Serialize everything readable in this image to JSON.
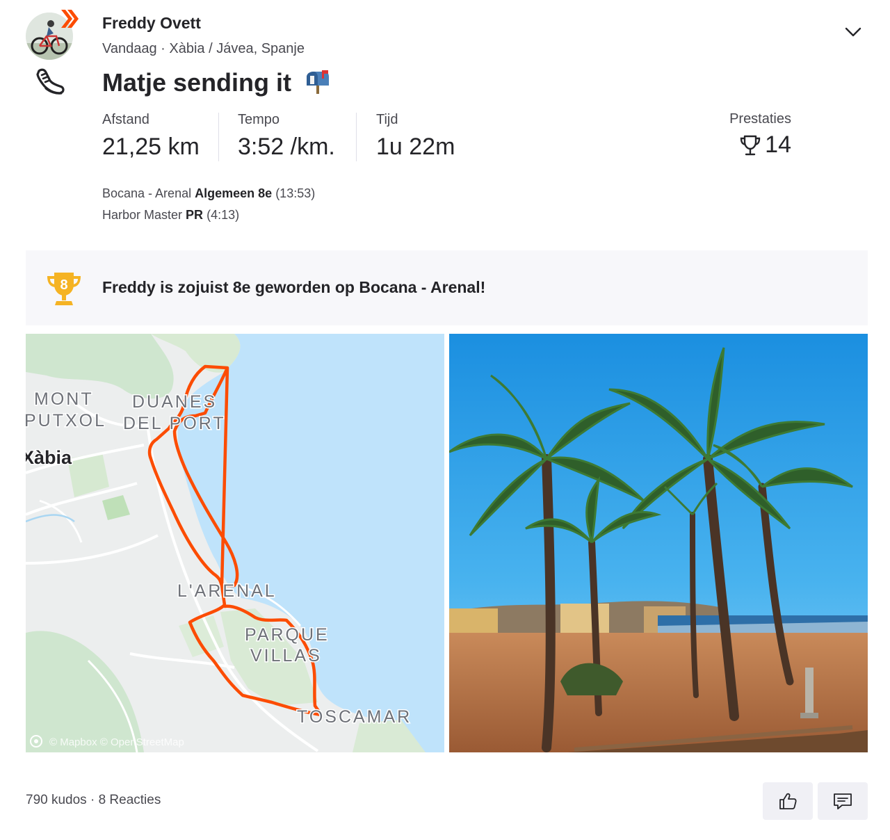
{
  "athlete": {
    "name": "Freddy Ovett",
    "date": "Vandaag",
    "separator": "·",
    "location": "Xàbia / Jávea, Spanje",
    "sport_icon": "running-shoe-icon",
    "badge_icon": "subscriber-chevron-icon"
  },
  "activity": {
    "title": "Matje sending it",
    "title_emoji": "mailbox-icon"
  },
  "stats": [
    {
      "label": "Afstand",
      "value": "21,25 km"
    },
    {
      "label": "Tempo",
      "value": "3:52 /km."
    },
    {
      "label": "Tijd",
      "value": "1u 22m"
    }
  ],
  "achievements": {
    "label": "Prestaties",
    "count": "14",
    "icon": "trophy-icon"
  },
  "segments": [
    {
      "name": "Bocana - Arenal",
      "result": "Algemeen 8e",
      "time": "(13:53)"
    },
    {
      "name": "Harbor Master",
      "result": "PR",
      "time": "(4:13)"
    }
  ],
  "banner": {
    "rank": "8",
    "text": "Freddy is zojuist 8e geworden op Bocana - Arenal!"
  },
  "map": {
    "labels": {
      "mont": "MONT",
      "putxol": "PUTXOL",
      "duanes": "DUANES",
      "del_port": "DEL PORT",
      "xabia": "Xàbia",
      "arenal": "L'ARENAL",
      "parque": "PARQUE",
      "villas": "VILLAS",
      "toscamar": "TOSCAMAR"
    },
    "attribution": "© Mapbox © OpenStreetMap",
    "colors": {
      "route": "#fc4c02",
      "sea": "#bfe3fb",
      "land": "#eceeee",
      "green": "#cfe6cf"
    }
  },
  "social": {
    "kudos": "790 kudos",
    "separator": "·",
    "comments": "8 Reacties"
  },
  "colors": {
    "brand": "#fc4c02",
    "trophy_gold": "#f5b323",
    "text": "#242428"
  }
}
